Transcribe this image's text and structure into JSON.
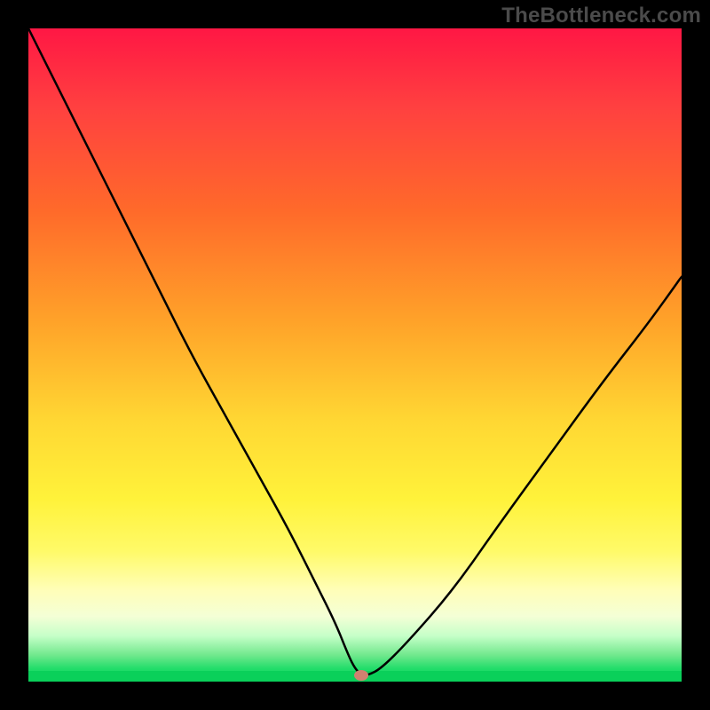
{
  "watermark": "TheBottleneck.com",
  "chart_data": {
    "type": "line",
    "title": "",
    "xlabel": "",
    "ylabel": "",
    "xlim": [
      0,
      100
    ],
    "ylim": [
      0,
      100
    ],
    "background_gradient": {
      "top": "#ff1744",
      "mid": "#ffd733",
      "bottom": "#0ad05a"
    },
    "series": [
      {
        "name": "bottleneck-curve",
        "x": [
          0,
          5,
          10,
          15,
          20,
          25,
          30,
          35,
          40,
          44,
          47,
          49,
          50,
          51,
          52,
          54,
          58,
          65,
          72,
          80,
          88,
          95,
          100
        ],
        "values": [
          100,
          90,
          80,
          70,
          60,
          50,
          41,
          32,
          23,
          15,
          9,
          4,
          2,
          1,
          1,
          2,
          6,
          14,
          24,
          35,
          46,
          55,
          62
        ]
      }
    ],
    "marker": {
      "x": 51,
      "y": 1,
      "color": "#d08070"
    },
    "grid": false,
    "legend": false
  }
}
